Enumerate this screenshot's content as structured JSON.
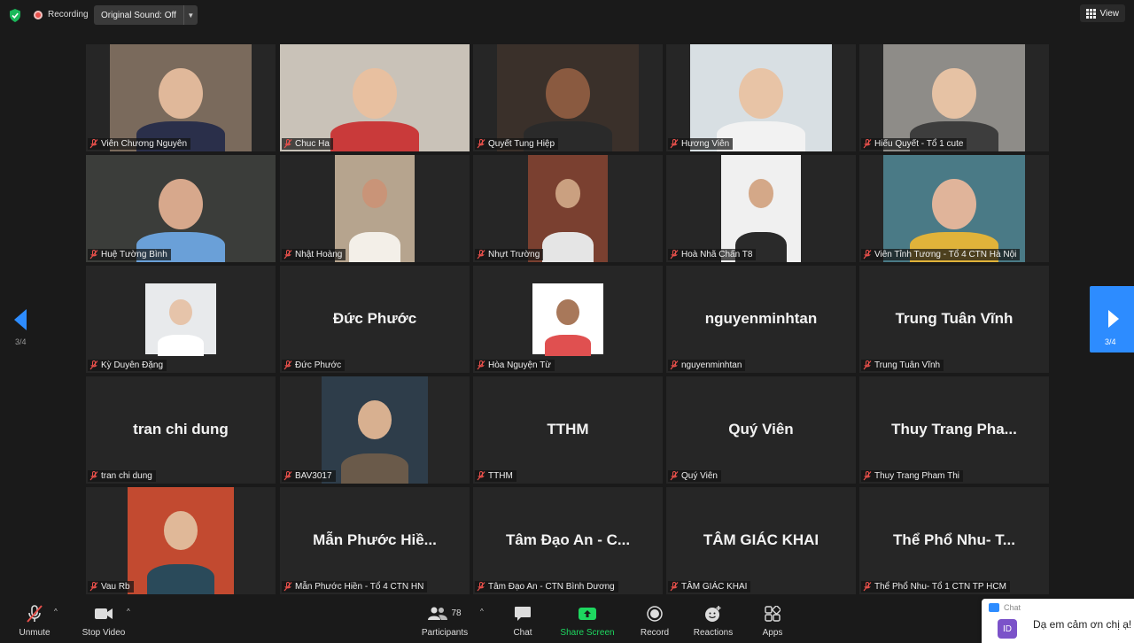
{
  "topbar": {
    "recording_label": "Recording",
    "original_sound_label": "Original Sound: Off",
    "view_label": "View"
  },
  "nav": {
    "page_left": "3/4",
    "page_right": "3/4"
  },
  "participants": [
    {
      "name": "Viên Chương Nguyên",
      "display": "",
      "type": "video"
    },
    {
      "name": "Chuc Ha",
      "display": "",
      "type": "video"
    },
    {
      "name": "Quyết Tung Hiệp",
      "display": "",
      "type": "video"
    },
    {
      "name": "Hương Viên",
      "display": "",
      "type": "video"
    },
    {
      "name": "Hiếu Quyết - Tổ 1 cute",
      "display": "",
      "type": "video"
    },
    {
      "name": "Huệ Tường Bình",
      "display": "",
      "type": "video"
    },
    {
      "name": "Nhật Hoàng",
      "display": "",
      "type": "video"
    },
    {
      "name": "Nhựt Trường",
      "display": "",
      "type": "video"
    },
    {
      "name": "Hoà Nhã Chấn T8",
      "display": "",
      "type": "video"
    },
    {
      "name": "Viên Tỉnh Tương - Tổ 4 CTN Hà Nội",
      "display": "",
      "type": "video"
    },
    {
      "name": "Kỳ Duyên Đặng",
      "display": "",
      "type": "photo"
    },
    {
      "name": "Đức Phước",
      "display": "Đức Phước",
      "type": "name"
    },
    {
      "name": "Hòa Nguyện Từ",
      "display": "",
      "type": "photo"
    },
    {
      "name": "nguyenminhtan",
      "display": "nguyenminhtan",
      "type": "name"
    },
    {
      "name": "Trung Tuân Vĩnh",
      "display": "Trung Tuân Vĩnh",
      "type": "name"
    },
    {
      "name": "tran chi dung",
      "display": "tran chi dung",
      "type": "name"
    },
    {
      "name": "BAV3017",
      "display": "",
      "type": "photo"
    },
    {
      "name": "TTHM",
      "display": "TTHM",
      "type": "name"
    },
    {
      "name": "Quý Viên",
      "display": "Quý Viên",
      "type": "name"
    },
    {
      "name": "Thuy Trang Pham Thi",
      "display": "Thuy Trang Pha...",
      "type": "name"
    },
    {
      "name": "Vau Rb",
      "display": "",
      "type": "photo"
    },
    {
      "name": "Mẫn Phước Hiền - Tổ 4 CTN HN",
      "display": "Mẫn Phước Hiề...",
      "type": "name"
    },
    {
      "name": "Tâm Đạo An - CTN Bình Dương",
      "display": "Tâm Đạo An - C...",
      "type": "name"
    },
    {
      "name": "TÂM GIÁC KHAI",
      "display": "TÂM GIÁC KHAI",
      "type": "name"
    },
    {
      "name": "Thể Phổ Nhu- Tổ 1 CTN TP HCM",
      "display": "Thể Phổ Nhu- T...",
      "type": "name"
    }
  ],
  "toolbar": {
    "unmute": "Unmute",
    "stop_video": "Stop Video",
    "participants_count": "78",
    "participants": "Participants",
    "chat": "Chat",
    "share_screen": "Share Screen",
    "record": "Record",
    "reactions": "Reactions",
    "apps": "Apps"
  },
  "chat_popup": {
    "header": "Chat",
    "avatar_initials": "ID",
    "message": "Dạ em cảm ơn chị ạ!"
  },
  "colors": {
    "accent": "#2d8cff",
    "share_green": "#1ed760",
    "record_red": "#e8504b"
  }
}
